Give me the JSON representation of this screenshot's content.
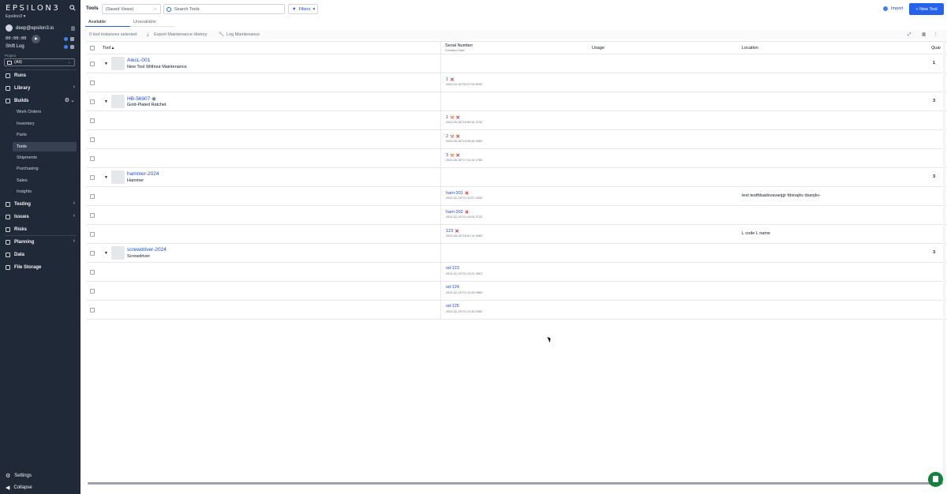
{
  "sidebar": {
    "logo": "EPSILON3",
    "workspace": "Epsilon3 ▾",
    "user_email": "deep@epsilon3.io",
    "timer": "00:00:00",
    "shift_log": "Shift Log",
    "project_label": "Project",
    "project_value": "(All)",
    "nav": {
      "runs": "Runs",
      "library": "Library",
      "builds": "Builds",
      "work_orders": "Work Orders",
      "inventory": "Inventory",
      "parts": "Parts",
      "tools": "Tools",
      "shipments": "Shipments",
      "purchasing": "Purchasing",
      "sales": "Sales",
      "insights": "Insights",
      "testing": "Testing",
      "issues": "Issues",
      "risks": "Risks",
      "planning": "Planning",
      "data": "Data",
      "file_storage": "File Storage",
      "settings": "Settings",
      "collapse": "Collapse"
    }
  },
  "header": {
    "title": "Tools",
    "views_placeholder": "(Saved Views)",
    "search_placeholder": "Search Tools",
    "filters_label": "Filters",
    "import_label": "Import",
    "new_tool_label": "+ New Tool"
  },
  "tabs": {
    "available": "Available",
    "unavailable": "Unavailable"
  },
  "actions": {
    "selected": "0 tool instances selected",
    "export": "Export Maintenance History",
    "log": "Log Maintenance"
  },
  "columns": {
    "tool": "Tool ▴",
    "serial": "Serial Number",
    "creation": "Creation Date",
    "usage": "Usage",
    "location": "Location",
    "quantity": "Quar"
  },
  "rows": {
    "g1": {
      "name": "AlecL-001",
      "desc": "New Tool Without Maintenance",
      "qty": "1"
    },
    "g1i1": {
      "serial": "1",
      "date": "2025-04-16T03:37:52.803Z",
      "location": ""
    },
    "g2": {
      "name": "HB-56907",
      "desc": "Gold-Plated Ratchet",
      "qty": "3"
    },
    "g2i1": {
      "serial": "1",
      "date": "2025-05-28T16:59:34.374Z"
    },
    "g2i2": {
      "serial": "2",
      "date": "2025-05-28T16:59:48.306Z"
    },
    "g2i3": {
      "serial": "3",
      "date": "2025-05-28T17:24:14.178Z"
    },
    "g3": {
      "name": "hammer-2024",
      "desc": "Hammer",
      "qty": "3"
    },
    "g3i1": {
      "serial": "ham-301",
      "date": "2024-02-13T21:12:57.183Z",
      "location": "test testfdsadsvavanjgr fdsnajkv dsanjkv-"
    },
    "g3i2": {
      "serial": "ham-302",
      "date": "2024-02-13T21:13:04.372Z"
    },
    "g3i3": {
      "serial": "123",
      "date": "2024-08-14T18:51:14.546Z",
      "location": "L code L name"
    },
    "g4": {
      "name": "screwdriver-2024",
      "desc": "Screwdriver",
      "qty": "3"
    },
    "g4i1": {
      "serial": "sd-123",
      "date": "2024-02-13T21:12:22.391Z"
    },
    "g4i2": {
      "serial": "sd-124",
      "date": "2024-02-13T21:12:28.086Z"
    },
    "g4i3": {
      "serial": "sd-125",
      "date": "2024-02-13T21:12:35.535Z"
    }
  },
  "colors": {
    "sidebar_bg": "#1f2937",
    "accent": "#2563eb",
    "status_red": "#dc2626",
    "status_orange": "#ea580c"
  }
}
